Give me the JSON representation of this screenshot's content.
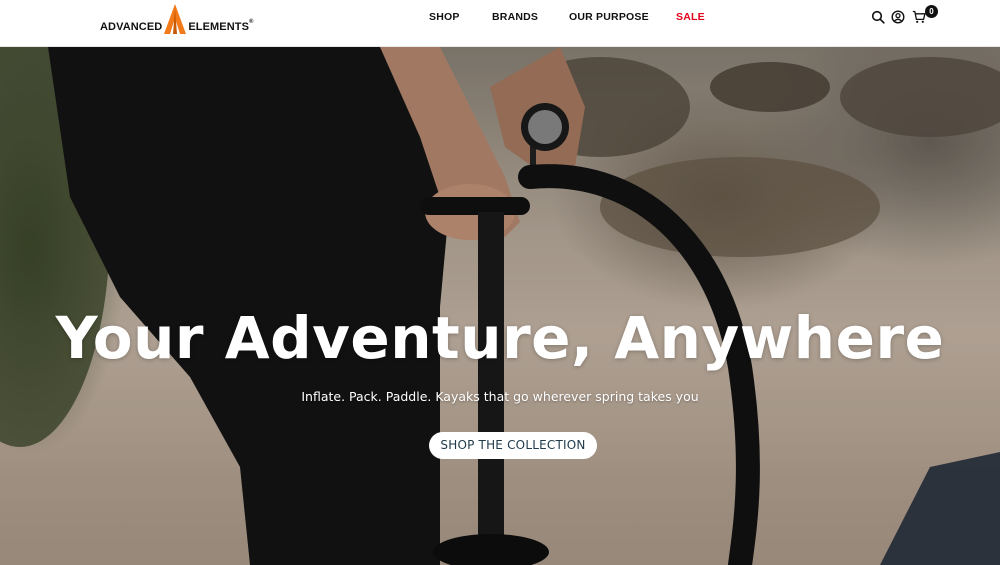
{
  "header": {
    "logo": {
      "left_text": "ADVANCED",
      "right_text": "ELEMENTS",
      "trademark": "®",
      "accent_color": "#f27a1a"
    },
    "nav": [
      {
        "label": "SHOP"
      },
      {
        "label": "BRANDS"
      },
      {
        "label": "OUR PURPOSE"
      },
      {
        "label": "SALE",
        "color": "#e0001b"
      }
    ],
    "icons": [
      "search-icon",
      "account-icon",
      "cart-icon"
    ],
    "cart_count": "0"
  },
  "hero": {
    "title": "Your Adventure, Anywhere",
    "subtitle": "Inflate. Pack. Paddle. Kayaks that go wherever spring takes you",
    "cta_label": "SHOP THE COLLECTION"
  }
}
